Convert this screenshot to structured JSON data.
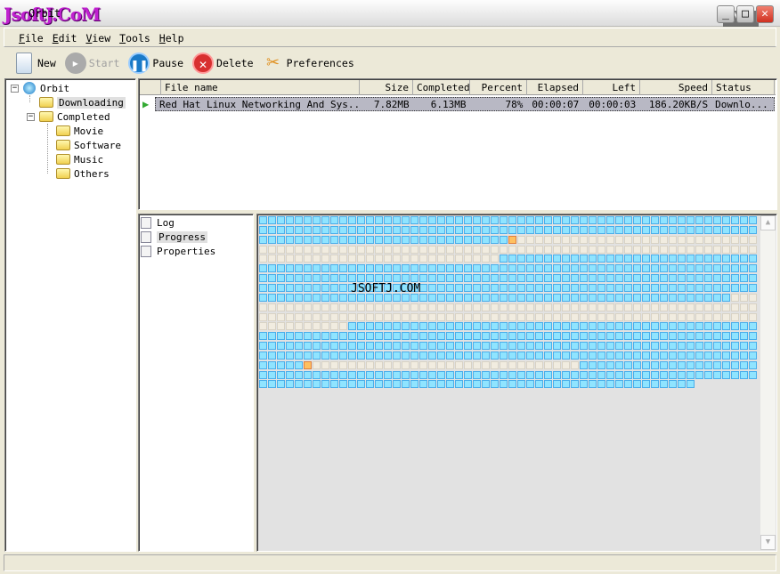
{
  "window": {
    "title": "Orbit",
    "logo_text": "JsoftJ.CoM",
    "watermark_logo": "NS HOSTING"
  },
  "menu": [
    "File",
    "Edit",
    "View",
    "Tools",
    "Help"
  ],
  "toolbar": {
    "new": "New",
    "start": "Start",
    "pause": "Pause",
    "delete": "Delete",
    "preferences": "Preferences"
  },
  "tree": {
    "root": "Orbit",
    "downloading": "Downloading",
    "completed": "Completed",
    "children": [
      "Movie",
      "Software",
      "Music",
      "Others"
    ]
  },
  "list": {
    "columns": [
      "File name",
      "Size",
      "Completed",
      "Percent",
      "Elapsed",
      "Left",
      "Speed",
      "Status"
    ],
    "rows": [
      {
        "name": "Red Hat Linux Networking And Sys...",
        "size": "7.82MB",
        "completed": "6.13MB",
        "percent": "78%",
        "elapsed": "00:00:07",
        "left": "00:00:03",
        "speed": "186.20KB/S",
        "status": "Downlo..."
      }
    ]
  },
  "views": [
    "Log",
    "Progress",
    "Properties"
  ],
  "progress": {
    "watermark": "JSOFTJ.COM",
    "columns": 56,
    "legend": {
      "D": "downloaded",
      "P": "pending",
      "A": "active"
    },
    "colors": {
      "D": "#8fe4ff",
      "P": "#f1ece0",
      "A": "#ffc060"
    },
    "rows": [
      "D56",
      "D56",
      "D28 A1 P27",
      "P56",
      "P27 D29",
      "D56",
      "D56",
      "D56",
      "D53 P3",
      "P56",
      "P56",
      "P10 D46",
      "D56",
      "D56",
      "D56",
      "D5 A1 P30 D20",
      "D56",
      "D49"
    ]
  }
}
